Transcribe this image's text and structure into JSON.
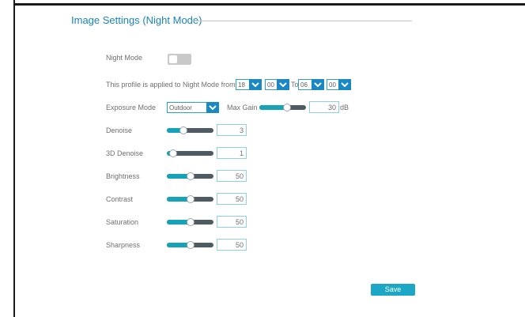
{
  "section": {
    "title": "Image Settings (Night Mode)"
  },
  "night_mode": {
    "label": "Night Mode",
    "enabled": false
  },
  "schedule": {
    "prefix": "This profile is applied to Night Mode from",
    "from_hour": "18",
    "from_min": "00",
    "to_label": "To",
    "to_hour": "06",
    "to_min": "00"
  },
  "exposure": {
    "label": "Exposure Mode",
    "mode": "Outdoor",
    "max_gain_label": "Max Gain",
    "max_gain_value": "30",
    "max_gain_level": 0.6,
    "unit": "dB"
  },
  "settings": [
    {
      "label": "Denoise",
      "value": "3",
      "level": 0.35
    },
    {
      "label": "3D Denoise",
      "value": "1",
      "level": 0.14
    },
    {
      "label": "Brightness",
      "value": "50",
      "level": 0.5
    },
    {
      "label": "Contrast",
      "value": "50",
      "level": 0.5
    },
    {
      "label": "Saturation",
      "value": "50",
      "level": 0.5
    },
    {
      "label": "Sharpness",
      "value": "50",
      "level": 0.5
    }
  ],
  "actions": {
    "save": "Save"
  },
  "colors": {
    "accent": "#1a84b8",
    "slider_fill": "#16a3b8",
    "slider_track": "#4e5b63",
    "button": "#1da7c6"
  }
}
